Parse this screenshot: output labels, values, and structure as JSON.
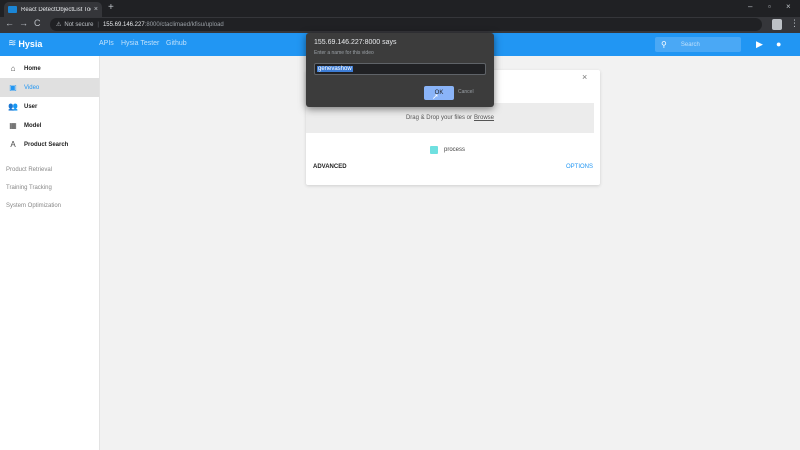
{
  "browser": {
    "tab_title": "React DetectObjectList Tool",
    "tab_close": "×",
    "new_tab": "+",
    "win_min": "–",
    "win_max": "▫",
    "win_close": "×",
    "back": "←",
    "forward": "→",
    "reload": "C",
    "not_secure": "Not secure",
    "url_host": "155.69.146.227",
    "url_rest": ":8000/ctaclimaed/kfisu/upload",
    "kebab": "⋮"
  },
  "header": {
    "brand": "Hysia",
    "links": [
      "APIs",
      "Hysia Tester",
      "Github"
    ],
    "search_placeholder": "Search",
    "brand_color": "#2196f3"
  },
  "sidebar": {
    "items": [
      {
        "label": "Home",
        "icon": "home-icon",
        "glyph": "⌂"
      },
      {
        "label": "Video",
        "icon": "video-icon",
        "glyph": "▣"
      },
      {
        "label": "User",
        "icon": "users-icon",
        "glyph": "👥"
      },
      {
        "label": "Model",
        "icon": "grid-icon",
        "glyph": "▦"
      },
      {
        "label": "Product Search",
        "icon": "product-icon",
        "glyph": "A"
      }
    ],
    "sections": [
      "Product Retrieval",
      "Training Tracking",
      "System Optimization"
    ]
  },
  "upload": {
    "dropzone_text": "Drag & Drop your files or",
    "browse_label": "Browse",
    "checkbox_label": "process",
    "advanced_label": "ADVANCED",
    "advanced_link": "OPTIONS",
    "close": "×"
  },
  "dialog": {
    "title": "155.69.146.227:8000 says",
    "message": "Enter a name for this video",
    "input_value": "genevashow",
    "ok_label": "OK",
    "cancel_label": "Cancel"
  }
}
